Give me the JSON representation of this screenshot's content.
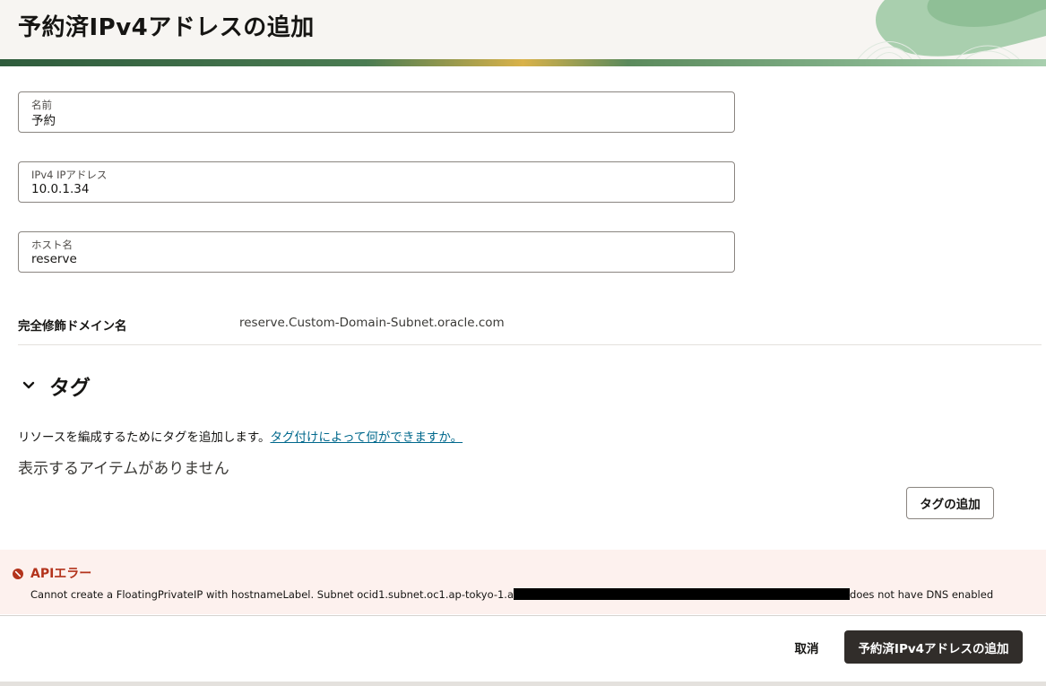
{
  "header": {
    "title": "予約済IPv4アドレスの追加"
  },
  "form": {
    "name": {
      "label": "名前",
      "value": "予約"
    },
    "ipv4": {
      "label": "IPv4 IPアドレス",
      "value": "10.0.1.34"
    },
    "hostname": {
      "label": "ホスト名",
      "value": "reserve"
    },
    "fqdn": {
      "label": "完全修飾ドメイン名",
      "value": "reserve.Custom-Domain-Subnet.oracle.com"
    }
  },
  "tags": {
    "title": "タグ",
    "description": "リソースを編成するためにタグを追加します。",
    "link": "タグ付けによって何ができますか。",
    "empty": "表示するアイテムがありません",
    "add_button": "タグの追加"
  },
  "error": {
    "title": "APIエラー",
    "message_start": "Cannot create a FloatingPrivateIP with hostnameLabel. Subnet ocid1.subnet.oc1.ap-tokyo-1.a",
    "message_end": "does not have DNS enabled"
  },
  "footer": {
    "cancel": "取消",
    "submit": "予約済IPv4アドレスの追加"
  },
  "icons": {
    "chevron": "chevron-down-icon",
    "error": "error-icon"
  },
  "colors": {
    "primary_button": "#312d2a",
    "error_text": "#b3331c",
    "error_bg": "#fdf1ee",
    "link": "#00688c"
  }
}
